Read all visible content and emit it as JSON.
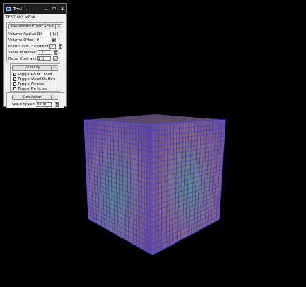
{
  "window": {
    "title": "Test ...",
    "controls": {
      "minimize": "–",
      "maximize": "☐",
      "close": "✕"
    }
  },
  "menu": {
    "caption": "TESTING MENU",
    "visualization": {
      "header": "Visualization and Scale",
      "fields": [
        {
          "label": "Volume Radius",
          "value": "10"
        },
        {
          "label": "Volume Offset",
          "value": "0"
        },
        {
          "label": "Point Cloud Exponent",
          "value": "7"
        },
        {
          "label": "Voxel Multiplier",
          "value": "1.0"
        },
        {
          "label": "Noise Contrast",
          "value": "1.0"
        }
      ]
    },
    "visibility": {
      "header": "Visibility",
      "items": [
        {
          "label": "Toggle Point Cloud",
          "checked": true
        },
        {
          "label": "Toggle Voxel Outline",
          "checked": true
        },
        {
          "label": "Toggle Arrows",
          "checked": false
        },
        {
          "label": "Toggle Particles",
          "checked": false
        }
      ]
    },
    "simulation": {
      "header": "Simulation",
      "fields": [
        {
          "label": "Wind Speed",
          "value": "0.0001"
        }
      ]
    },
    "collapse_glyph": "–"
  },
  "viewport": {
    "object": "voxel-cube",
    "grid_divisions": 24,
    "colors": {
      "background": "#000000",
      "grid": "#3a3ae0",
      "fill_warm": "#c07890",
      "fill_cool": "#6fb890"
    }
  }
}
